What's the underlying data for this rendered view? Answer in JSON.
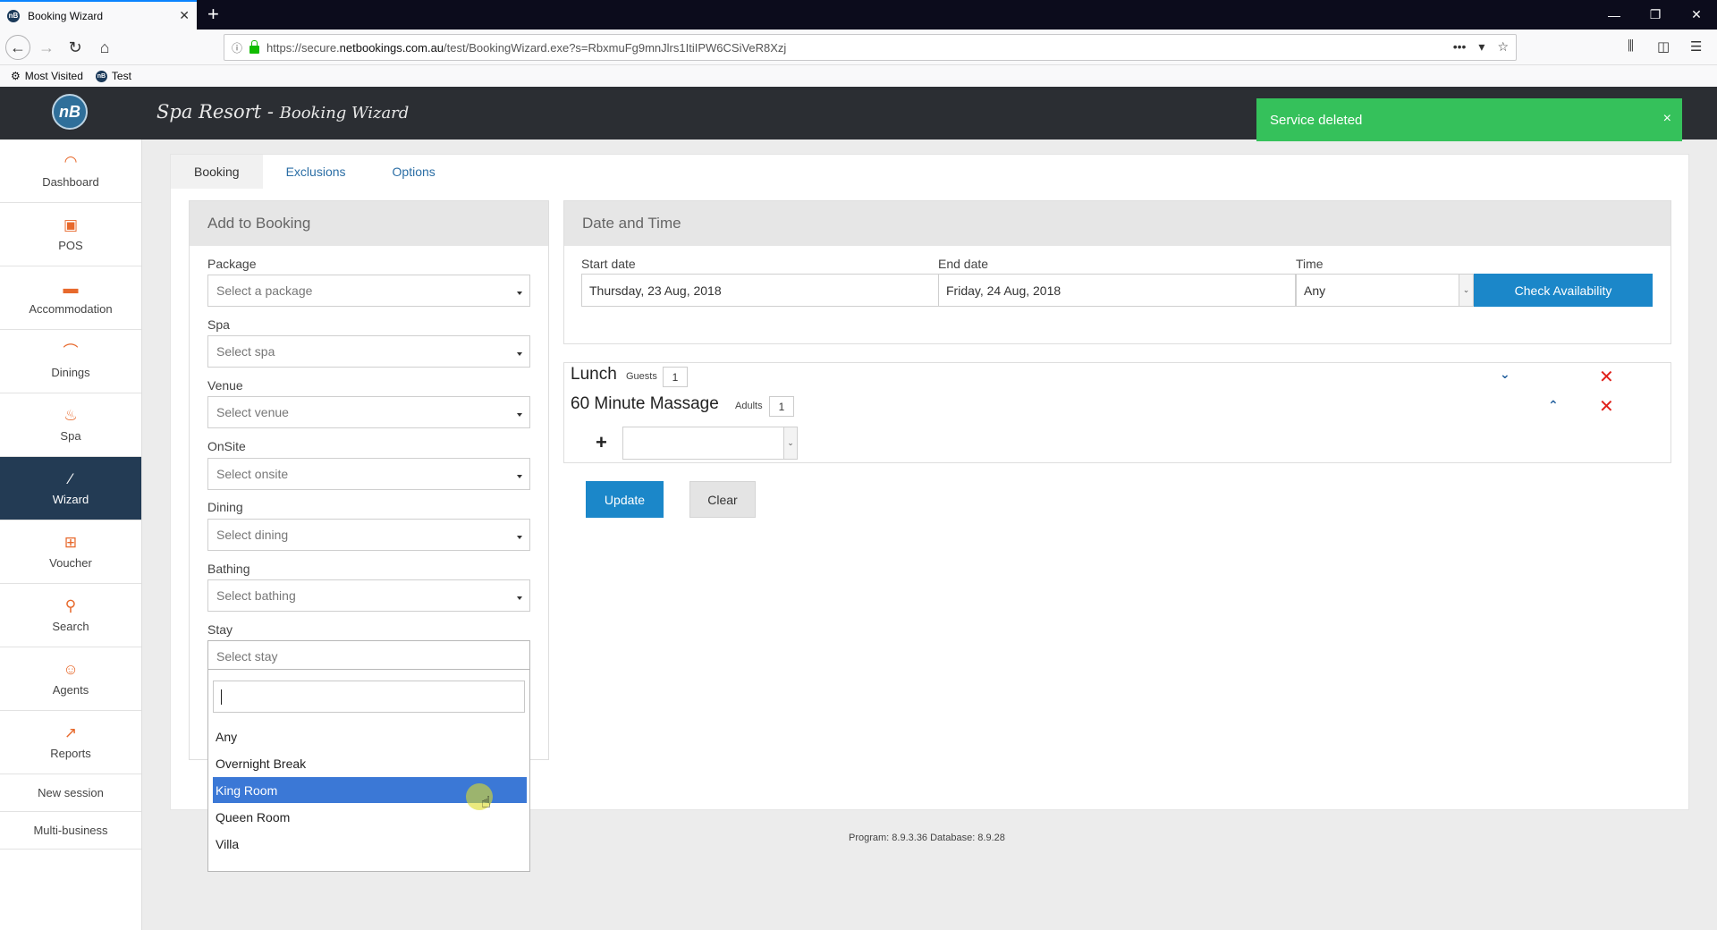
{
  "browser": {
    "tab_title": "Booking Wizard",
    "tab_favicon": "nB",
    "url_prefix": "https://secure.",
    "url_domain": "netbookings.com.au",
    "url_path": "/test/BookingWizard.exe?s=RbxmuFg9mnJlrs1ItiIPW6CSiVeR8Xzj",
    "bookmarks": [
      {
        "label": "Most Visited",
        "icon": "gear-icon"
      },
      {
        "label": "Test",
        "icon": "nb-favicon"
      }
    ]
  },
  "header": {
    "logo": "nB",
    "title": "Spa Resort",
    "separator": " - ",
    "subtitle": "Booking Wizard"
  },
  "toast": {
    "message": "Service deleted",
    "close": "×",
    "color": "#35c15b"
  },
  "sidebar": {
    "items": [
      {
        "label": "Dashboard",
        "icon": "dashboard-icon"
      },
      {
        "label": "POS",
        "icon": "pos-icon"
      },
      {
        "label": "Accommodation",
        "icon": "bed-icon"
      },
      {
        "label": "Dinings",
        "icon": "dining-icon"
      },
      {
        "label": "Spa",
        "icon": "spa-icon"
      },
      {
        "label": "Wizard",
        "icon": "wand-icon",
        "active": true
      },
      {
        "label": "Voucher",
        "icon": "gift-icon"
      },
      {
        "label": "Search",
        "icon": "search-icon"
      },
      {
        "label": "Agents",
        "icon": "agent-icon"
      },
      {
        "label": "Reports",
        "icon": "chart-icon"
      }
    ],
    "links": [
      "New session",
      "Multi-business"
    ]
  },
  "tabs": [
    "Booking",
    "Exclusions",
    "Options"
  ],
  "add_to_booking": {
    "heading": "Add to Booking",
    "fields": [
      {
        "label": "Package",
        "placeholder": "Select a package"
      },
      {
        "label": "Spa",
        "placeholder": "Select spa"
      },
      {
        "label": "Venue",
        "placeholder": "Select venue"
      },
      {
        "label": "OnSite",
        "placeholder": "Select onsite"
      },
      {
        "label": "Dining",
        "placeholder": "Select dining"
      },
      {
        "label": "Bathing",
        "placeholder": "Select bathing"
      },
      {
        "label": "Stay",
        "placeholder": "Select stay"
      }
    ],
    "stay_dropdown": {
      "search_value": "",
      "options": [
        "Any",
        "Overnight Break",
        "King Room",
        "Queen Room",
        "Villa"
      ],
      "highlighted": "King Room"
    }
  },
  "date_time": {
    "heading": "Date and Time",
    "start_label": "Start date",
    "start_value": "Thursday, 23 Aug, 2018",
    "end_label": "End date",
    "end_value": "Friday, 24 Aug, 2018",
    "time_label": "Time",
    "time_value": "Any",
    "check_button": "Check Availability"
  },
  "services": [
    {
      "name": "Lunch",
      "qty_label": "Guests",
      "qty": "1",
      "chevron": "down"
    },
    {
      "name": "60 Minute Massage",
      "qty_label": "Adults",
      "qty": "1",
      "chevron": "up"
    }
  ],
  "add_service": {
    "plus": "+",
    "value": ""
  },
  "actions": {
    "update": "Update",
    "clear": "Clear"
  },
  "footer": {
    "version": "Program: 8.9.3.36 Database: 8.9.28"
  },
  "colors": {
    "accent": "#1b87c9",
    "sidebar_active": "#233b54",
    "icon_orange": "#e7692c",
    "delete_red": "#e0201a"
  }
}
